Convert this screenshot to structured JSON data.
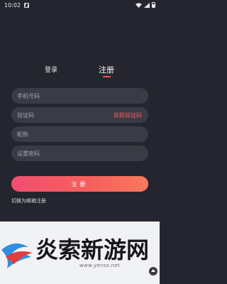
{
  "status_bar": {
    "time": "10:02"
  },
  "tabs": {
    "login": "登录",
    "register": "注册"
  },
  "form": {
    "phone_placeholder": "手机号码",
    "code_placeholder": "验证码",
    "get_code": "获取验证码",
    "nickname_placeholder": "昵称",
    "password_placeholder": "设置密码"
  },
  "register_button": "注册",
  "switch_email": "切换为邮箱注册",
  "watermark": {
    "text": "炎索新游网",
    "url": "www.yenso.net"
  },
  "colors": {
    "background": "#25252f",
    "field": "#3b3b46",
    "accent": "#ff4f4f"
  }
}
